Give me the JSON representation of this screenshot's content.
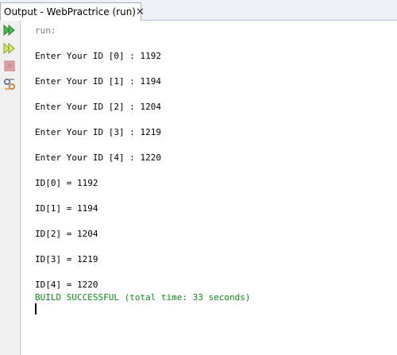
{
  "tab": {
    "title": "Output - WebPractrice (run)",
    "close_glyph": "✕"
  },
  "toolbar": {
    "buttons": [
      {
        "name": "rerun-icon"
      },
      {
        "name": "rerun-with-options-icon"
      },
      {
        "name": "stop-icon"
      },
      {
        "name": "settings-icon"
      }
    ]
  },
  "output": {
    "lines": [
      "run:",
      "Enter Your ID [0] : 1192",
      "Enter Your ID [1] : 1194",
      "Enter Your ID [2] : 1204",
      "Enter Your ID [3] : 1219",
      "Enter Your ID [4] : 1220",
      "ID[0] = 1192",
      "ID[1] = 1194",
      "ID[2] = 1204",
      "ID[3] = 1219",
      "ID[4] = 1220",
      "BUILD SUCCESSFUL (total time: 33 seconds)"
    ]
  },
  "colors": {
    "run_text": "#7a7a7a",
    "build_success": "#0e8a16",
    "tab_bar": "#eef2f8"
  }
}
